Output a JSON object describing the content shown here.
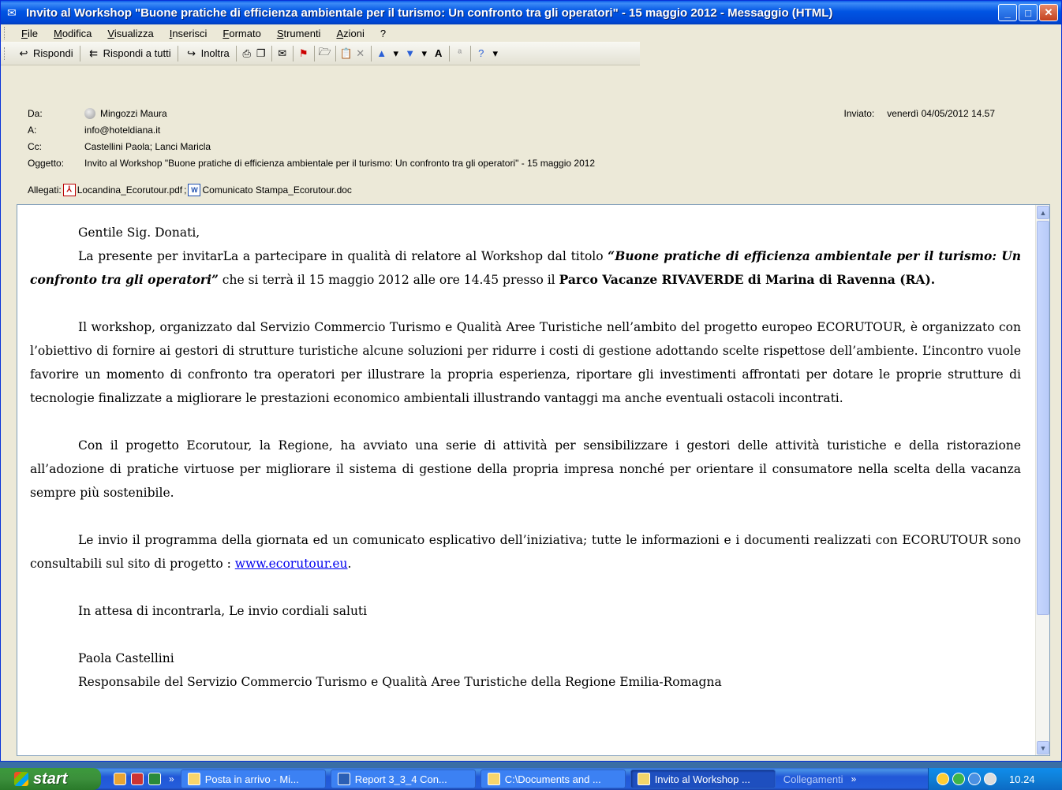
{
  "window": {
    "title": "Invito al Workshop  \"Buone pratiche  di efficienza  ambientale  per  il turismo: Un confronto tra gli operatori\" - 15 maggio 2012 - Messaggio (HTML)",
    "minimize": "_",
    "maximize": "□",
    "close": "✕"
  },
  "menu": [
    "File",
    "Modifica",
    "Visualizza",
    "Inserisci",
    "Formato",
    "Strumenti",
    "Azioni",
    "?"
  ],
  "toolbar": {
    "reply": "Rispondi",
    "reply_all": "Rispondi a tutti",
    "forward": "Inoltra"
  },
  "header": {
    "from_label": "Da:",
    "from": "Mingozzi Maura",
    "to_label": "A:",
    "to": "info@hoteldiana.it",
    "cc_label": "Cc:",
    "cc": "Castellini Paola; Lanci Maricla",
    "subject_label": "Oggetto:",
    "subject": "Invito al Workshop  \"Buone pratiche  di efficienza  ambientale  per  il turismo: Un confronto tra gli operatori\" - 15 maggio 2012",
    "sent_label": "Inviato:",
    "sent": "venerdì 04/05/2012 14.57",
    "attachments_label": "Allegati:",
    "attachment1": "Locandina_Ecorutour.pdf",
    "attachment_sep": ";",
    "attachment2": "Comunicato Stampa_Ecorutour.doc"
  },
  "body": {
    "greeting": "Gentile  Sig.  Donati,",
    "p1_a": "La presente  per invitarLa a  partecipare  in qualità di relatore al Workshop dal titolo ",
    "p1_title": "“Buone pratiche  di efficienza  ambientale  per  il turismo: Un confronto tra gli operatori”",
    "p1_b": " che si terrà il 15 maggio 2012 alle  ore  14.45 presso il ",
    "p1_place": "Parco Vacanze RIVAVERDE di Marina di Ravenna (RA).",
    "p2": "Il workshop, organizzato  dal Servizio Commercio Turismo e Qualità Aree Turistiche nell’ambito del progetto europeo  ECORUTOUR,  è organizzato con l’obiettivo di fornire ai gestori di strutture turistiche alcune soluzioni per ridurre i costi di gestione  adottando scelte rispettose dell’ambiente. L’incontro vuole  favorire  un momento di confronto tra operatori  per  illustrare  la propria  esperienza, riportare gli investimenti affrontati per dotare le proprie strutture di tecnologie finalizzate a migliorare  le prestazioni economico ambientali  illustrando vantaggi  ma anche eventuali ostacoli incontrati.",
    "p3": "Con il progetto Ecorutour,  la Regione,  ha avviato una serie di attività per sensibilizzare i gestori delle attività turistiche e della ristorazione all’adozione di pratiche virtuose per migliorare il sistema di gestione della propria impresa nonché per orientare il consumatore nella scelta della vacanza sempre più sostenibile.",
    "p4_a": "Le invio il programma della  giornata ed un comunicato esplicativo dell’iniziativa; tutte le informazioni e i documenti realizzati con ECORUTOUR sono consultabili sul sito di progetto : ",
    "p4_link": "www.ecorutour.eu",
    "p4_b": ".",
    "closing": "In attesa di incontrarla, Le invio cordiali saluti",
    "signature_name": "Paola Castellini",
    "signature_role": "Responsabile del Servizio Commercio Turismo e Qualità Aree Turistiche della Regione Emilia-Romagna"
  },
  "taskbar": {
    "start": "start",
    "tasks": [
      "Posta in arrivo - Mi...",
      "Report 3_3_4  Con...",
      "C:\\Documents and ...",
      "Invito al Workshop ..."
    ],
    "links_label": "Collegamenti",
    "chevron": "»",
    "clock": "10.24"
  },
  "colors": {
    "titlebar": "#0054e3",
    "link": "#0000ee",
    "start_button": "#3b8f3b"
  }
}
